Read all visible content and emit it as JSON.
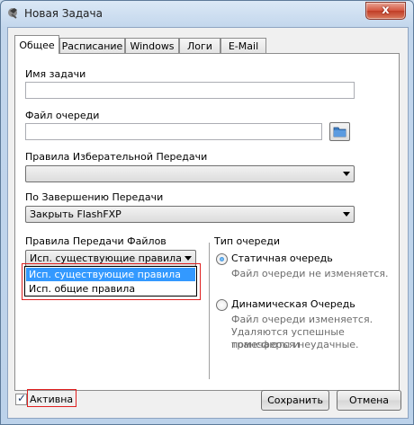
{
  "window": {
    "title": "Новая Задача",
    "close_glyph": "x"
  },
  "tabs": [
    {
      "label": "Общее"
    },
    {
      "label": "Расписание"
    },
    {
      "label": "Windows"
    },
    {
      "label": "Логи"
    },
    {
      "label": "E-Mail"
    }
  ],
  "general": {
    "task_name_label": "Имя задачи",
    "task_name_value": "",
    "queue_file_label": "Файл очереди",
    "queue_file_value": "",
    "selective_transfer_label": "Правила Изберательной Передачи",
    "selective_transfer_value": "",
    "on_complete_label": "По Завершению Передачи",
    "on_complete_value": "Закрыть FlashFXP",
    "file_rules_label": "Правила Передачи Файлов",
    "file_rules_value": "Исп. существующие правила",
    "file_rules_options": [
      {
        "label": "Исп. существующие правила",
        "selected": true
      },
      {
        "label": "Исп. общие правила",
        "selected": false
      }
    ]
  },
  "queue_type": {
    "label": "Тип очереди",
    "static_label": "Статичная очередь",
    "static_hint": "Файл очереди не изменяется.",
    "static_checked": true,
    "dynamic_label": "Динамическая Очередь",
    "dynamic_hint_lines": [
      "Файл очереди изменяется.",
      "Удаляются успешные трансферы и",
      "помечаются неудачные."
    ],
    "dynamic_checked": false
  },
  "footer": {
    "active_label": "Активна",
    "active_checked": true,
    "save_label": "Сохранить",
    "cancel_label": "Отмена"
  },
  "colors": {
    "accent_selection": "#3399ff",
    "highlight_frame": "#e02020"
  }
}
